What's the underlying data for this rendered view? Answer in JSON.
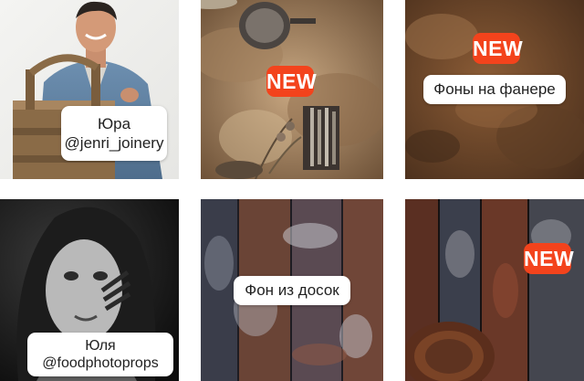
{
  "tiles": [
    {
      "label_line1": "Юра",
      "label_line2": "@jenri_joinery"
    },
    {
      "badge": "NEW"
    },
    {
      "badge": "NEW",
      "label": "Фоны на фанере"
    },
    {
      "label_line1": "Юля",
      "label_line2": "@foodphotoprops"
    },
    {
      "label": "Фон из досок"
    },
    {
      "badge": "NEW"
    }
  ],
  "colors": {
    "badge_bg": "#f3431c",
    "label_bg": "#ffffff"
  }
}
